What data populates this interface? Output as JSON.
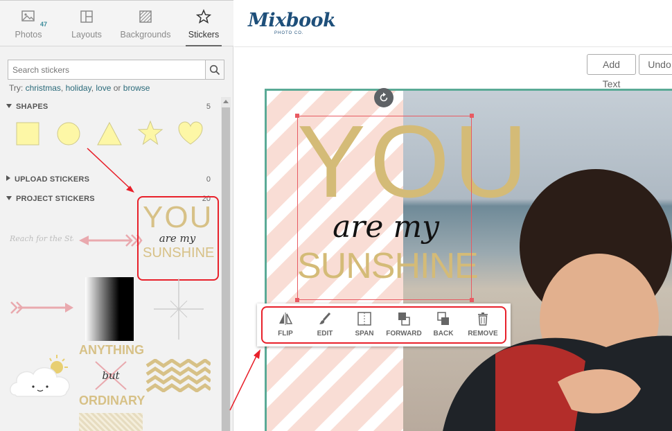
{
  "tabs": [
    {
      "label": "Photos",
      "icon": "photos-icon",
      "badge": "47"
    },
    {
      "label": "Layouts",
      "icon": "layouts-icon"
    },
    {
      "label": "Backgrounds",
      "icon": "backgrounds-icon"
    },
    {
      "label": "Stickers",
      "icon": "star-icon",
      "active": true
    }
  ],
  "search": {
    "placeholder": "Search stickers"
  },
  "suggestions": {
    "prefix": "Try:",
    "items": [
      "christmas",
      "holiday",
      "love"
    ],
    "or": "or",
    "browse": "browse"
  },
  "sections": {
    "shapes": {
      "label": "SHAPES",
      "count": "5"
    },
    "upload": {
      "label": "UPLOAD STICKERS",
      "count": "0"
    },
    "project": {
      "label": "PROJECT STICKERS",
      "count": "20"
    }
  },
  "stickers": {
    "reach": "Reach for the Stars",
    "you1": "YOU",
    "you2": "are my",
    "you3": "SUNSHINE",
    "any1": "ANYTHING",
    "any2": "but",
    "any3": "ORDINARY"
  },
  "brand": {
    "name": "Mixbook",
    "sub": "PHOTO CO.",
    "color": "#1e4f7a"
  },
  "toolbar": {
    "add_text": "Add Text",
    "undo": "Undo"
  },
  "canvas_text": {
    "line1": "YOU",
    "line2": "are my",
    "line3": "SUNSHINE"
  },
  "actions": {
    "flip": "FLIP",
    "edit": "EDIT",
    "span": "SPAN",
    "forward": "FORWARD",
    "back": "BACK",
    "remove": "REMOVE"
  },
  "colors": {
    "accent": "#5aaa96",
    "highlight": "#e8202a",
    "gold": "#d4bb77"
  }
}
